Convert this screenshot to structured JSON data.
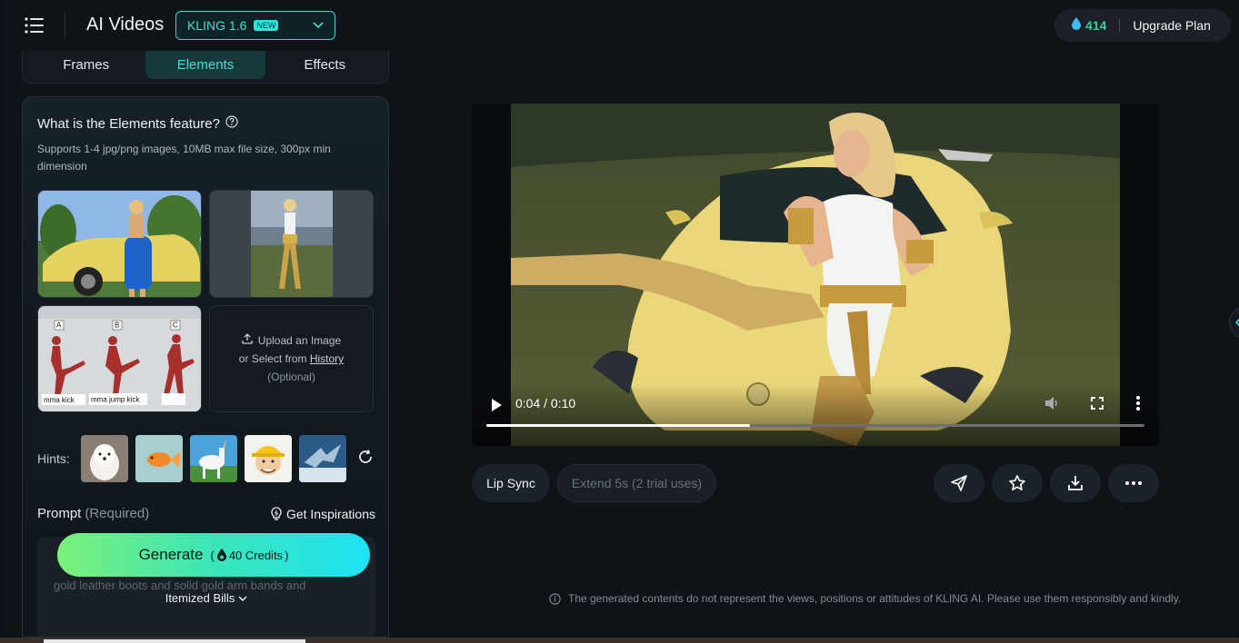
{
  "header": {
    "app_title": "AI Videos",
    "model_select": {
      "name": "KLING 1.6",
      "badge": "NEW"
    },
    "credits": "414",
    "upgrade_label": "Upgrade Plan"
  },
  "tabs": [
    {
      "label": "Frames",
      "active": false
    },
    {
      "label": "Elements",
      "active": true
    },
    {
      "label": "Effects",
      "active": false
    }
  ],
  "panel": {
    "title": "What is the Elements feature?",
    "description": "Supports 1-4 jpg/png images, 10MB max file size, 300px min dimension",
    "reference_labels": [
      "A",
      "B",
      "C"
    ],
    "reference_captions": [
      "mma kick",
      "mma jump kick"
    ],
    "upload": {
      "line1": "Upload an Image",
      "line2_prefix": "or Select from",
      "history_link": "History",
      "optional": "(Optional)"
    },
    "hints_label": "Hints:",
    "prompt_label": "Prompt",
    "prompt_required": "(Required)",
    "get_inspirations": "Get Inspirations",
    "prompt_text": "gold leather boots and solid gold arm bands and",
    "generate_label": "Generate",
    "generate_credits": "40 Credits",
    "itemized_bills": "Itemized Bills"
  },
  "video": {
    "current_time": "0:04",
    "duration": "0:10",
    "time_display": "0:04 / 0:10",
    "progress": 0.4
  },
  "actions": {
    "lip_sync": "Lip Sync",
    "extend": "Extend 5s (2 trial uses)"
  },
  "disclaimer": "The generated contents do not represent the views, positions or attitudes of KLING AI. Please use them responsibly and kindly.",
  "colors": {
    "accent": "#3fe0d4",
    "credits_green": "#34d399",
    "background": "#0f1318"
  }
}
